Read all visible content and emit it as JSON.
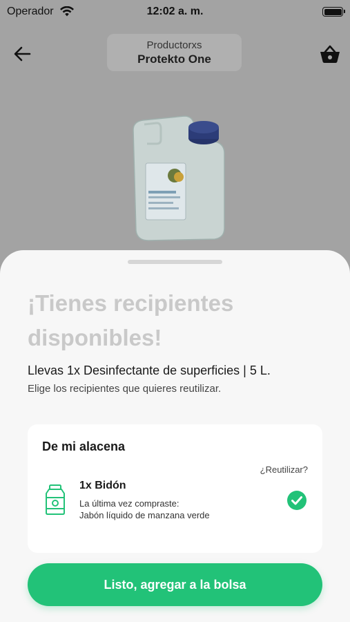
{
  "status_bar": {
    "carrier": "Operador",
    "time": "12:02 a. m."
  },
  "nav": {
    "subtitle": "Productorxs",
    "title": "Protekto One",
    "back_icon": "arrow-left-icon",
    "basket_icon": "basket-icon"
  },
  "sheet": {
    "title": "¡Tienes recipientes disponibles!",
    "summary": "Llevas 1x Desinfectante de superficies | 5 L.",
    "instruction": "Elige los recipientes que quieres reutilizar."
  },
  "pantry_card": {
    "title": "De mi alacena",
    "reuse_label": "¿Reutilizar?",
    "item": {
      "name": "1x  Bidón",
      "last_purchase_label": "La última vez compraste:",
      "last_purchase_product": "Jabón líquido de manzana verde",
      "selected": true,
      "icon": "jar-icon"
    }
  },
  "cta": {
    "label": "Listo, agregar a la bolsa"
  },
  "colors": {
    "accent": "#22c278",
    "overlay": "#a3a3a3",
    "sheet_bg": "#f7f7f7"
  }
}
